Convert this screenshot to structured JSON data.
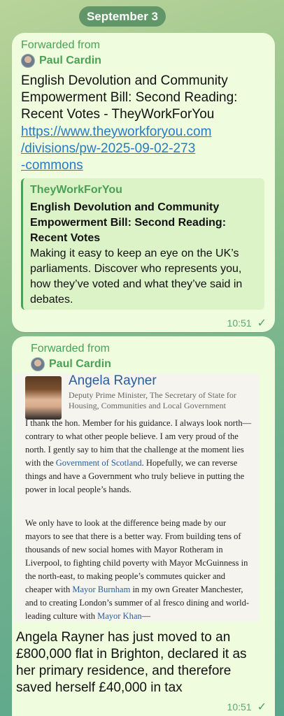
{
  "date_pill": "September 3",
  "message1": {
    "forwarded_label": "Forwarded from",
    "author": "Paul Cardin",
    "text": "English Devolution and Community Empowerment Bill: Second Reading: Recent Votes - TheyWorkForYou",
    "link_line1": "https://www.theyworkforyou.com",
    "link_line2": "/divisions/pw-2025-09-02-273",
    "link_line3": "-commons",
    "preview": {
      "site": "TheyWorkForYou",
      "title": "English Devolution and Community Empowerment Bill: Second Reading: Recent Votes",
      "description": "Making it easy to keep an eye on the UK’s parliaments. Discover who represents you, how they’ve voted and what they’ve said in debates."
    },
    "time": "10:51"
  },
  "message2": {
    "forwarded_label": "Forwarded from",
    "author": "Paul Cardin",
    "image": {
      "name": "Angela Rayner",
      "role": "Deputy Prime Minister, The Secretary of State for Housing, Communities and Local Government",
      "para1_a": "I thank the hon. Member for his guidance. I always look north—contrary to what other people believe. I am very proud of the north. I gently say to him that the challenge at the moment lies with the ",
      "para1_link": "Government of Scotland",
      "para1_b": ". Hopefully, we can reverse things and have a Government who truly believe in putting the power in local people’s hands.",
      "para2_a": "We only have to look at the difference being made by our mayors to see that there is a better way. From building tens of thousands of new social homes with Mayor Rotheram in Liverpool, to fighting child poverty with Mayor McGuinness in the north-east, to making people’s commutes quicker and cheaper with ",
      "para2_link1": "Mayor Burnham",
      "para2_b": " in my own Greater Manchester, and to creating London’s summer of al fresco dining and world-leading culture with ",
      "para2_link2": "Mayor Khan",
      "para2_c": "—"
    },
    "caption": "Angela Rayner has just moved to an £800,000 flat in Brighton, declared it as her primary residence, and therefore saved herself £40,000 in tax",
    "time": "10:51"
  },
  "colors": {
    "bubble": "#effdde",
    "accent_green": "#4aa155",
    "link_blue": "#2a7ac0"
  },
  "icons": [
    "avatar",
    "check-icon"
  ]
}
